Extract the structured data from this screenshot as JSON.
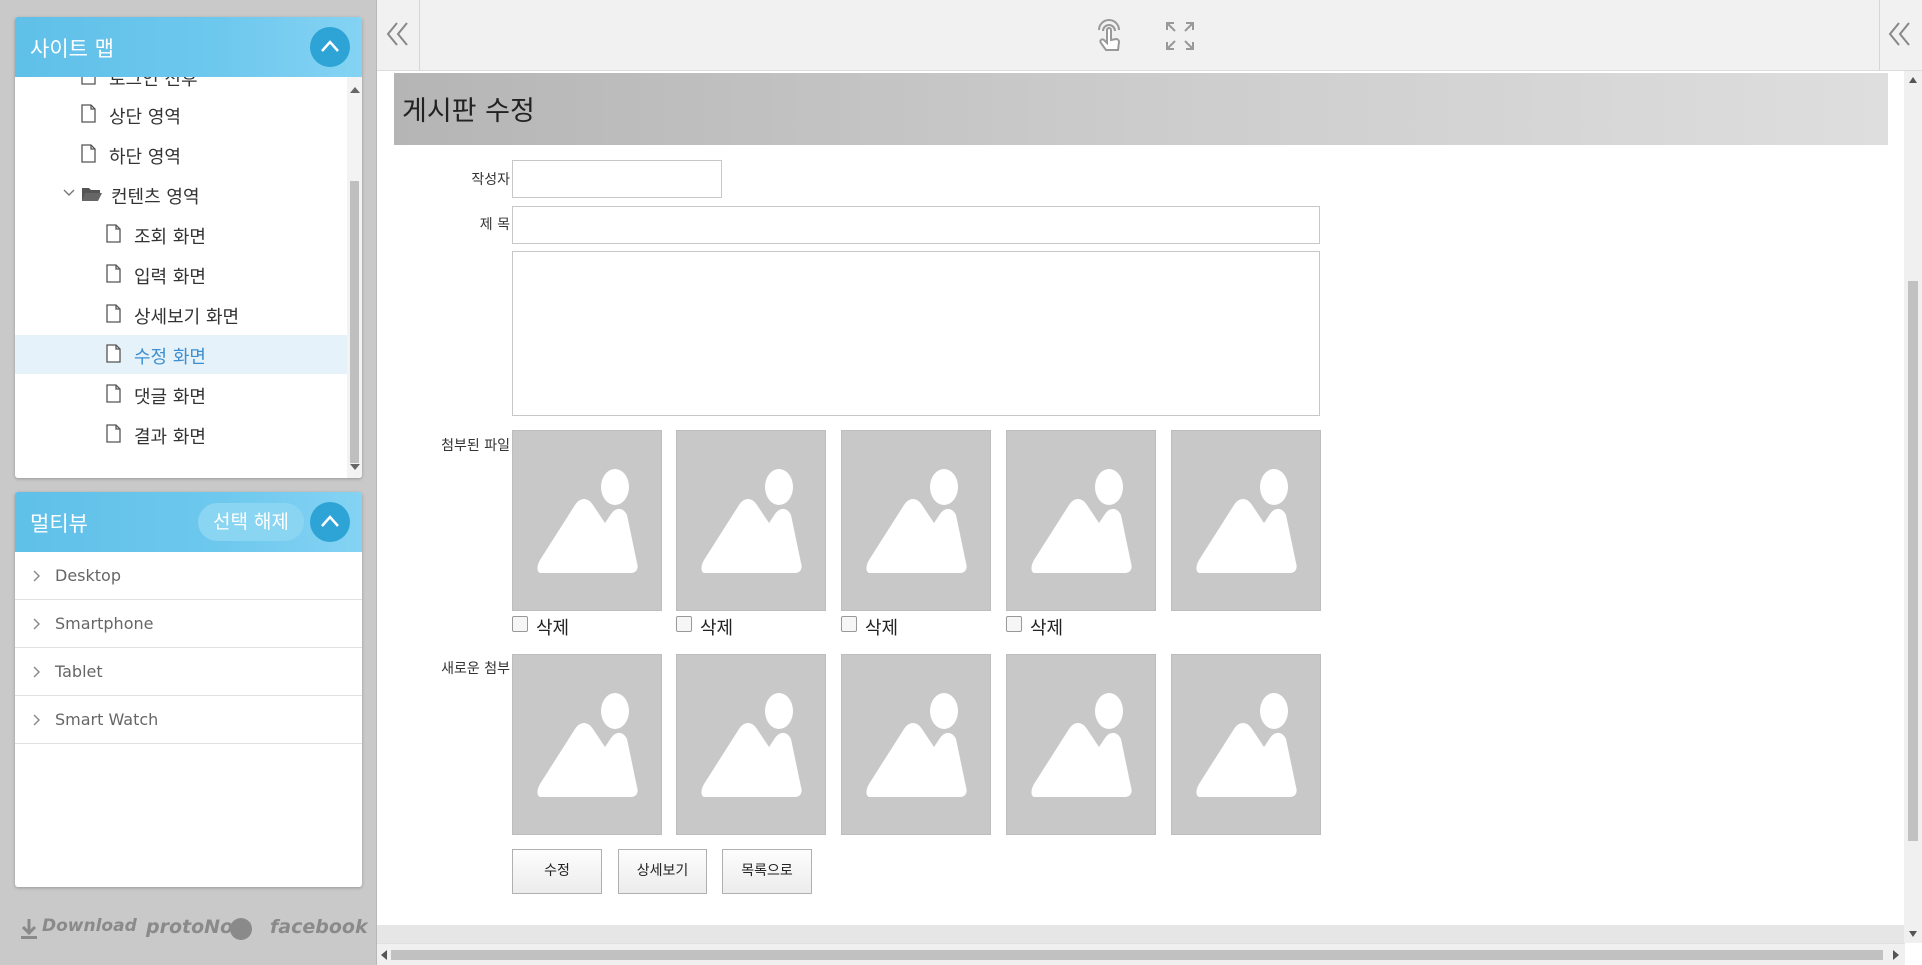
{
  "sitemap": {
    "title": "사이트 맵",
    "items": [
      {
        "label": "로그인 전후"
      },
      {
        "label": "상단 영역"
      },
      {
        "label": "하단 영역"
      },
      {
        "label": "컨텐츠 영역"
      },
      {
        "label": "조회 화면"
      },
      {
        "label": "입력 화면"
      },
      {
        "label": "상세보기 화면"
      },
      {
        "label": "수정 화면"
      },
      {
        "label": "댓글 화면"
      },
      {
        "label": "결과 화면"
      }
    ],
    "selected": "수정 화면"
  },
  "multiview": {
    "title": "멀티뷰",
    "deselect_label": "선택 해제",
    "items": [
      {
        "label": "Desktop"
      },
      {
        "label": "Smartphone"
      },
      {
        "label": "Tablet"
      },
      {
        "label": "Smart Watch"
      }
    ]
  },
  "footer": {
    "download": "Download",
    "protonow": "protoNow",
    "facebook": "facebook"
  },
  "page": {
    "title": "게시판 수정",
    "author_label": "작성자",
    "subject_label": "제 목",
    "attached_label": "첨부된 파일",
    "new_attach_label": "새로운 첨부",
    "delete_label": "삭제",
    "buttons": {
      "edit": "수정",
      "detail": "상세보기",
      "list": "목록으로"
    }
  },
  "colors": {
    "header_blue": "#5fc0e8",
    "button_blue": "#2da3d6",
    "selected_text": "#3d8fd0",
    "image_placeholder": "#c8c8c8"
  }
}
